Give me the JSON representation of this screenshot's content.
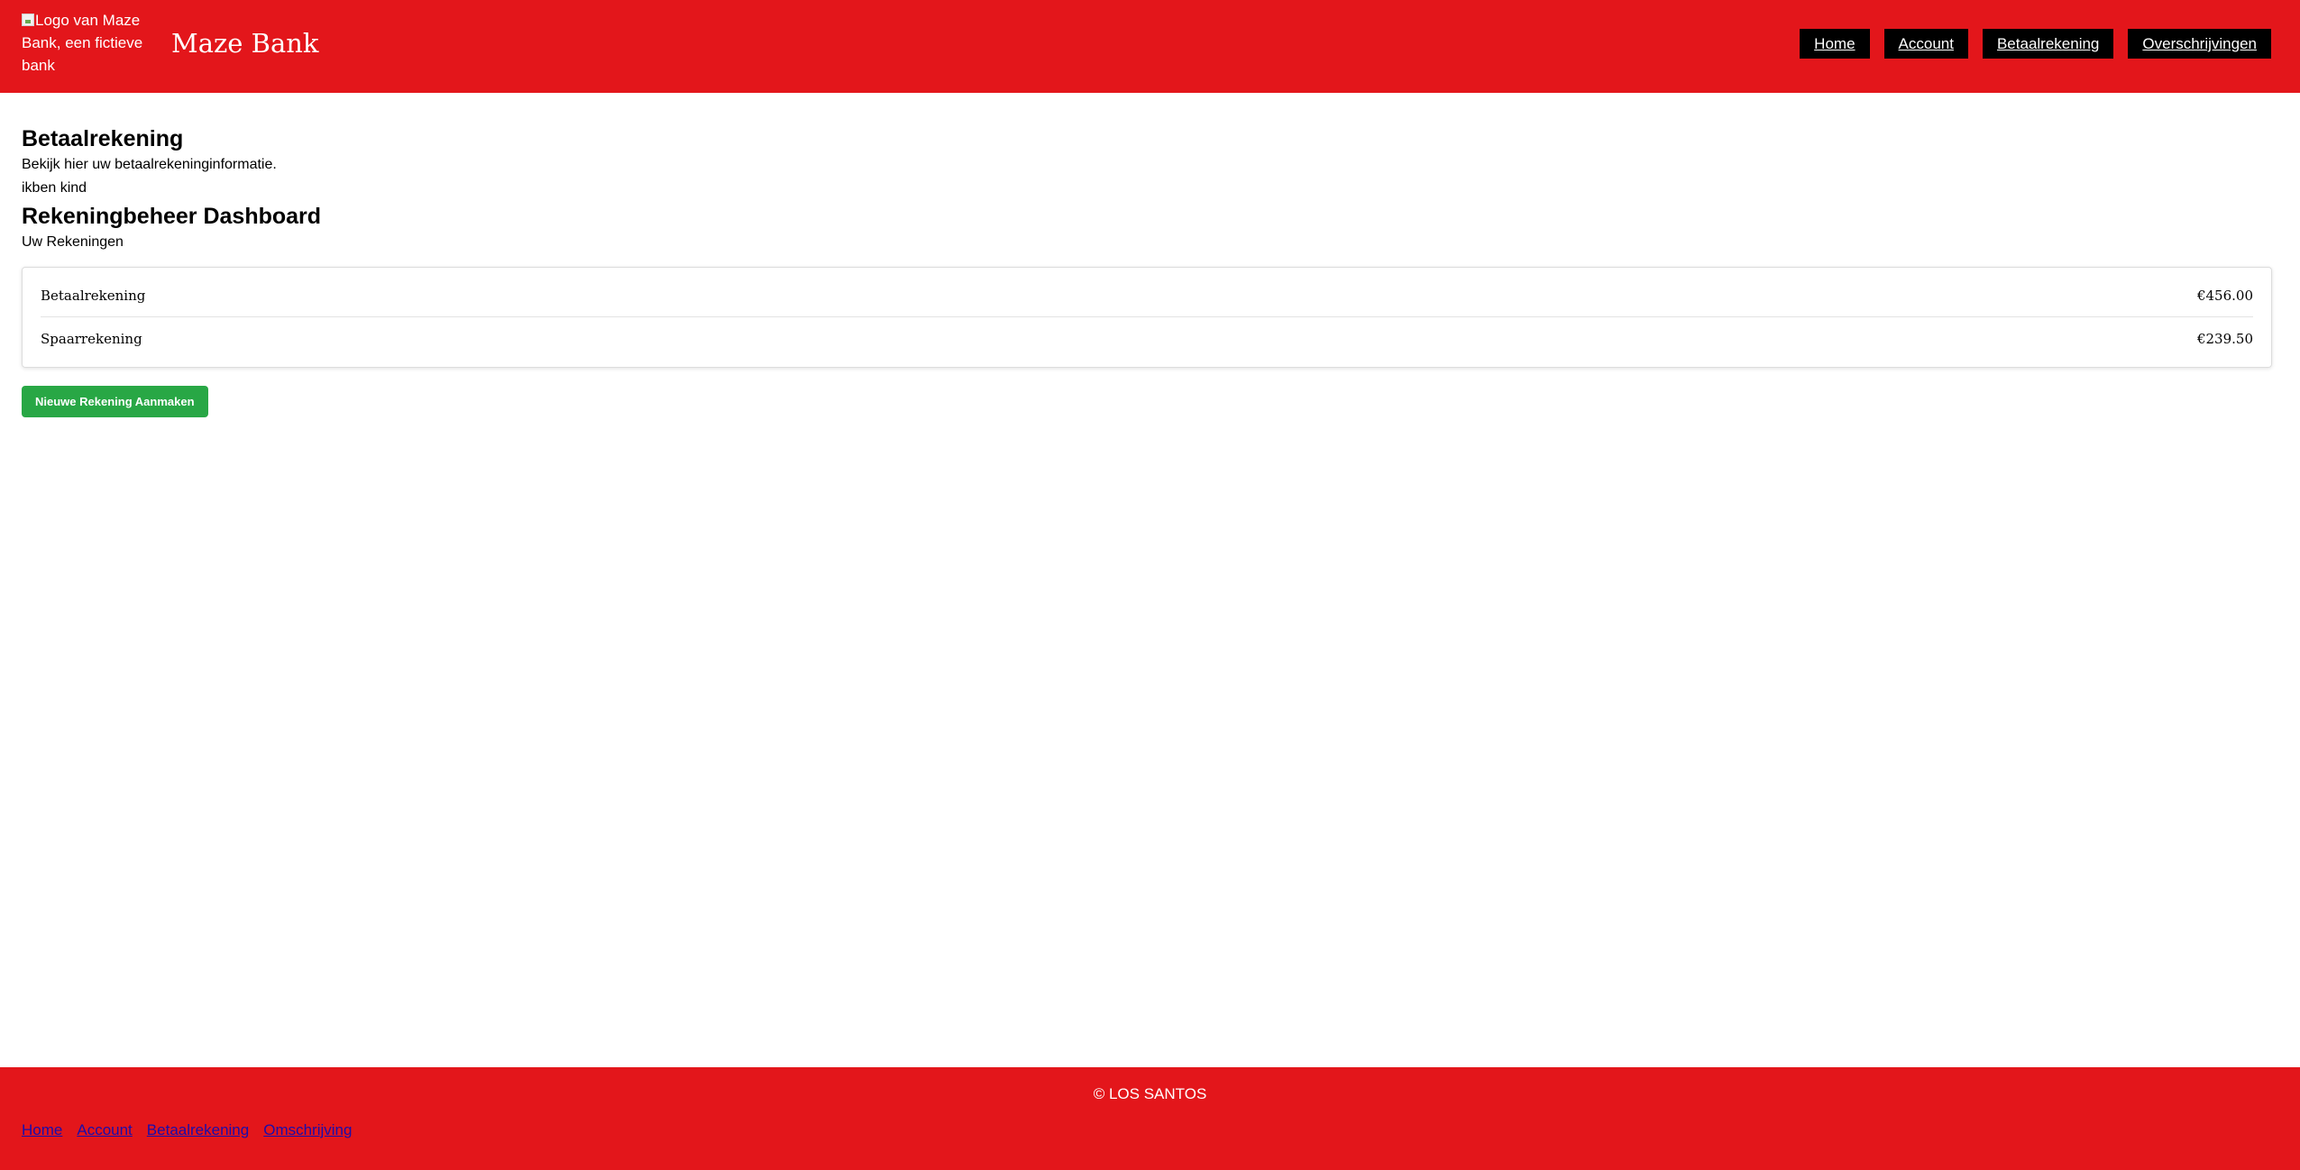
{
  "header": {
    "logo_alt": "Logo van Maze Bank, een fictieve bank",
    "brand_name": "Maze Bank",
    "nav": [
      {
        "label": "Home"
      },
      {
        "label": "Account"
      },
      {
        "label": "Betaalrekening"
      },
      {
        "label": "Overschrijvingen"
      }
    ]
  },
  "main": {
    "title": "Betaalrekening",
    "description": "Bekijk hier uw betaalrekeninginformatie.",
    "child_text": "ikben kind",
    "dashboard_title": "Rekeningbeheer Dashboard",
    "accounts_label": "Uw Rekeningen",
    "accounts": [
      {
        "name": "Betaalrekening",
        "balance": "€456.00"
      },
      {
        "name": "Spaarrekening",
        "balance": "€239.50"
      }
    ],
    "new_account_button": "Nieuwe Rekening Aanmaken"
  },
  "footer": {
    "copyright": "© LOS SANTOS",
    "links": [
      {
        "label": "Home"
      },
      {
        "label": "Account"
      },
      {
        "label": "Betaalrekening"
      },
      {
        "label": "Omschrijving"
      }
    ]
  },
  "colors": {
    "brand_red": "#e3161b",
    "nav_button_bg": "#000000",
    "primary_button_green": "#28a745",
    "footer_link": "#1a0dab"
  }
}
